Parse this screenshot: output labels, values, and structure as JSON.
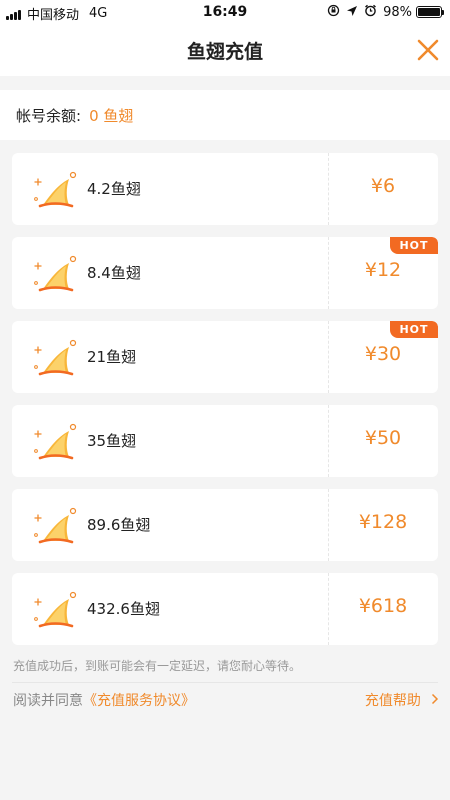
{
  "status_bar": {
    "carrier": "中国移动",
    "network": "4G",
    "time": "16:49",
    "battery": "98%",
    "battery_level": 0.98
  },
  "nav": {
    "title": "鱼翅充值",
    "close_icon": "close-icon"
  },
  "balance": {
    "label": "帐号余额:",
    "value": "0 鱼翅"
  },
  "packages": [
    {
      "amount": "4.2鱼翅",
      "price": "¥6",
      "badge": ""
    },
    {
      "amount": "8.4鱼翅",
      "price": "¥12",
      "badge": "HOT"
    },
    {
      "amount": "21鱼翅",
      "price": "¥30",
      "badge": "HOT"
    },
    {
      "amount": "35鱼翅",
      "price": "¥50",
      "badge": ""
    },
    {
      "amount": "89.6鱼翅",
      "price": "¥128",
      "badge": ""
    },
    {
      "amount": "432.6鱼翅",
      "price": "¥618",
      "badge": ""
    }
  ],
  "notice": "充值成功后，到账可能会有一定延迟，请您耐心等待。",
  "footer": {
    "read_text": "阅读并同意",
    "agreement": "《充值服务协议》",
    "help": "充值帮助"
  },
  "colors": {
    "accent": "#f08a2c",
    "hot_badge": "#f26a22",
    "background": "#f4f4f4"
  }
}
